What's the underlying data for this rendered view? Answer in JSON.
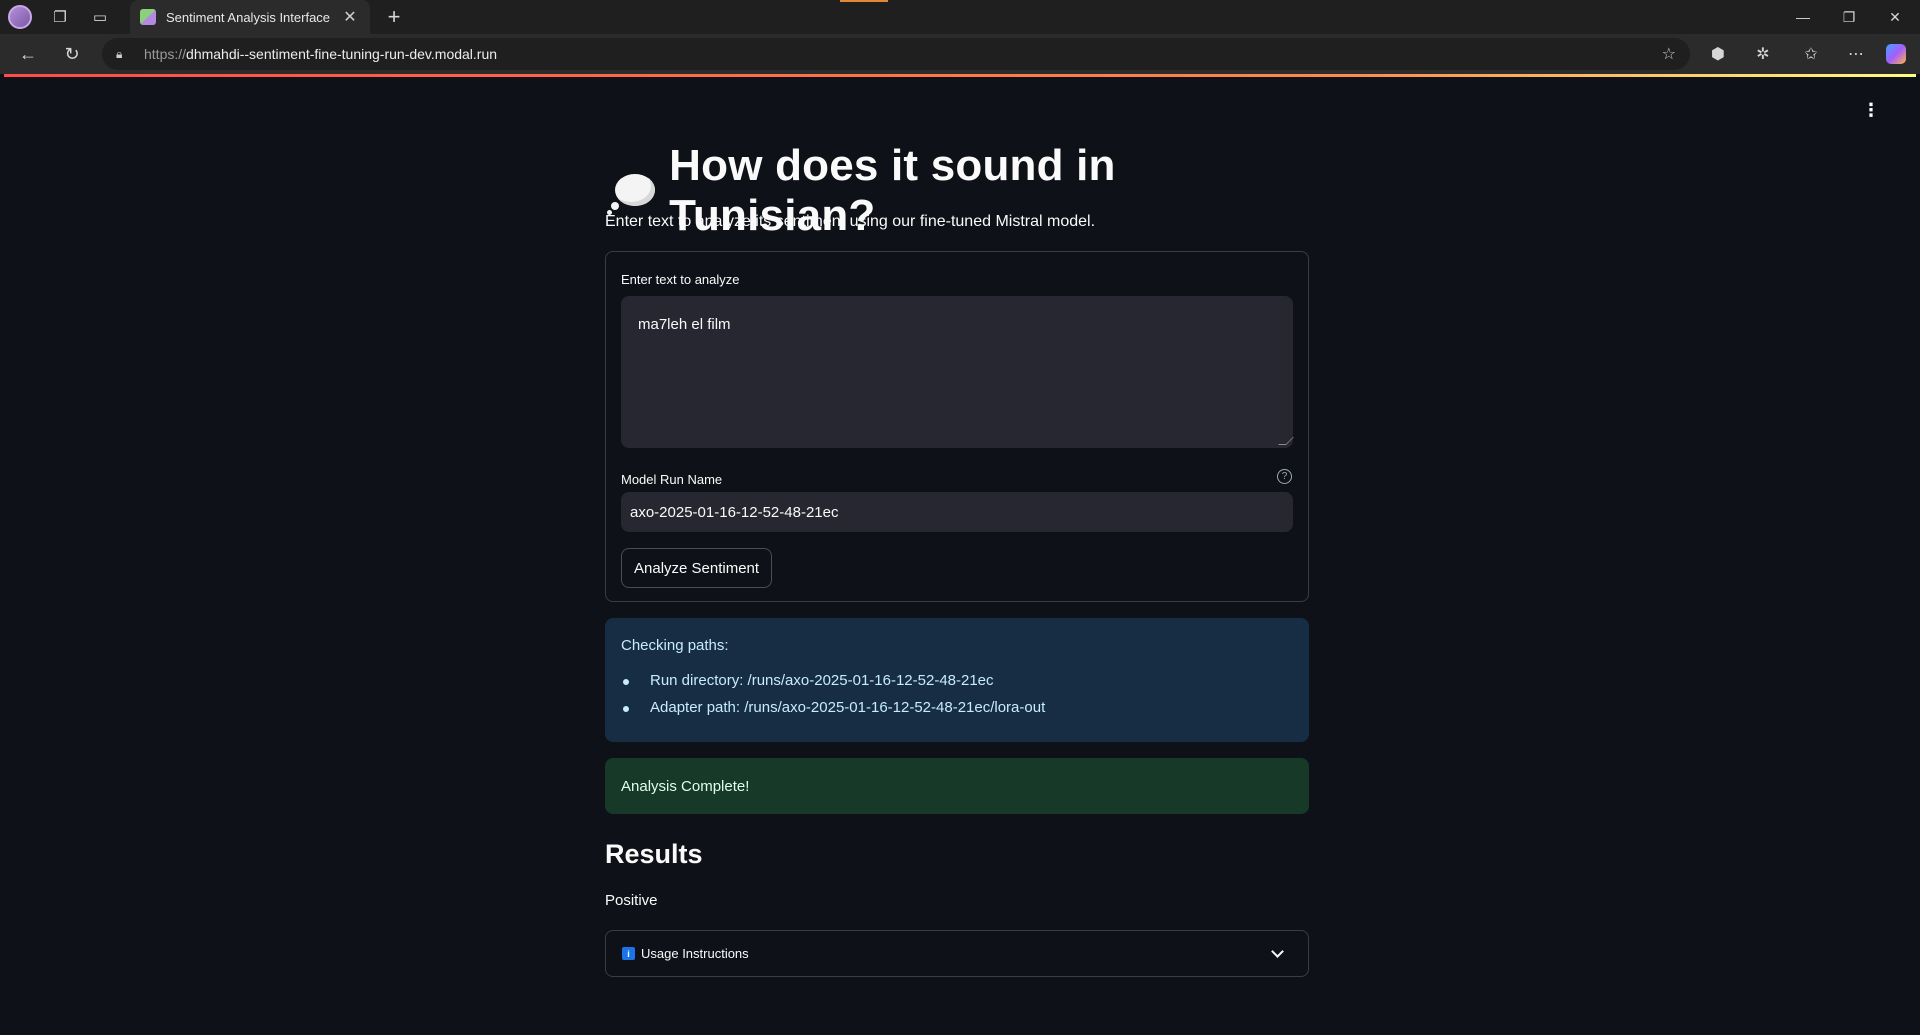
{
  "browser": {
    "tab_title": "Sentiment Analysis Interface",
    "url_prefix": "https://",
    "url_host": "dhmahdi--sentiment-fine-tuning-run-dev.modal.run"
  },
  "app": {
    "title": "How does it sound in Tunisian?",
    "subtitle": "Enter text to analyze its sentiment using our fine-tuned Mistral model.",
    "form": {
      "text_label": "Enter text to analyze",
      "text_value": "ma7leh el film",
      "run_label": "Model Run Name",
      "run_value": "axo-2025-01-16-12-52-48-21ec",
      "button_label": "Analyze Sentiment"
    },
    "info_box": {
      "heading": "Checking paths:",
      "items": [
        "Run directory: /runs/axo-2025-01-16-12-52-48-21ec",
        "Adapter path: /runs/axo-2025-01-16-12-52-48-21ec/lora-out"
      ]
    },
    "success_message": "Analysis Complete!",
    "results_heading": "Results",
    "results_value": "Positive",
    "expander_label": "Usage Instructions"
  },
  "icons": {
    "title_emoji": "thought-balloon",
    "info_emoji": "information-source",
    "accent_gradient": [
      "#ff4b4b",
      "#fd8a4a",
      "#fffd80"
    ]
  }
}
